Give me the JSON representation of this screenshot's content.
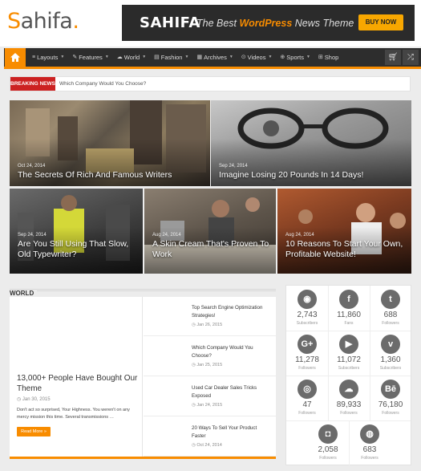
{
  "header": {
    "logo_s": "S",
    "logo_rest": "ahifa",
    "logo_dot": ".",
    "banner_brand": "SAHIFA",
    "banner_tag_pre": "The Best ",
    "banner_tag_bold": "WordPress",
    "banner_tag_post": " News Theme",
    "banner_button": "BUY NOW"
  },
  "nav": {
    "items": [
      {
        "icon": "≡",
        "label": "Layouts"
      },
      {
        "icon": "✎",
        "label": "Features"
      },
      {
        "icon": "☁",
        "label": "World"
      },
      {
        "icon": "▤",
        "label": "Fashion"
      },
      {
        "icon": "▦",
        "label": "Archives"
      },
      {
        "icon": "⊙",
        "label": "Videos"
      },
      {
        "icon": "⊕",
        "label": "Sports"
      },
      {
        "icon": "⊞",
        "label": "Shop"
      }
    ],
    "cart_icon": "cart-icon",
    "random_icon": "shuffle-icon"
  },
  "breaking": {
    "label": "Breaking News",
    "text": "Which Company Would You Choose?"
  },
  "slider": [
    {
      "date": "Oct 24, 2014",
      "title": "The Secrets Of Rich And Famous Writers"
    },
    {
      "date": "Sep 24, 2014",
      "title": "Imagine Losing 20 Pounds In 14 Days!"
    },
    {
      "date": "Sep 24, 2014",
      "title": "Are You Still Using That Slow, Old Typewriter?"
    },
    {
      "date": "Aug 24, 2014",
      "title": "A Skin Cream That's Proven To Work"
    },
    {
      "date": "Aug 24, 2014",
      "title": "10 Reasons To Start Your Own, Profitable Website!"
    }
  ],
  "world": {
    "heading": "World",
    "featured": {
      "title": "13,000+ People Have Bought Our Theme",
      "date": "Jan 30, 2015",
      "excerpt": "Don't act so surprised, Your Highness. You weren't on any mercy mission this time. Several transmissions …",
      "more": "Read More »"
    },
    "posts": [
      {
        "title": "Top Search Engine Optimization Strategies!",
        "date": "Jan 26, 2015"
      },
      {
        "title": "Which Company Would You Choose?",
        "date": "Jan 25, 2015"
      },
      {
        "title": "Used Car Dealer Sales Tricks Exposed",
        "date": "Jan 24, 2015"
      },
      {
        "title": "20 Ways To Sell Your Product Faster",
        "date": "Oct 24, 2014"
      }
    ]
  },
  "social": [
    {
      "icon": "rss-icon",
      "glyph": "◉",
      "count": "2,743",
      "label": "Subscribers"
    },
    {
      "icon": "facebook-icon",
      "glyph": "f",
      "count": "11,860",
      "label": "Fans"
    },
    {
      "icon": "twitter-icon",
      "glyph": "t",
      "count": "688",
      "label": "Followers"
    },
    {
      "icon": "googleplus-icon",
      "glyph": "G+",
      "count": "11,278",
      "label": "Followers"
    },
    {
      "icon": "youtube-icon",
      "glyph": "▶",
      "count": "11,072",
      "label": "Subscribers"
    },
    {
      "icon": "vimeo-icon",
      "glyph": "v",
      "count": "1,360",
      "label": "Subscribers"
    },
    {
      "icon": "dribbble-icon",
      "glyph": "◎",
      "count": "47",
      "label": "Followers"
    },
    {
      "icon": "soundcloud-icon",
      "glyph": "☁",
      "count": "89,933",
      "label": "Followers"
    },
    {
      "icon": "behance-icon",
      "glyph": "Bē",
      "count": "76,180",
      "label": "Followers"
    },
    {
      "icon": "instagram-icon",
      "glyph": "◘",
      "count": "2,058",
      "label": "Followers"
    },
    {
      "icon": "github-icon",
      "glyph": "◍",
      "count": "683",
      "label": "Followers"
    }
  ],
  "colors": {
    "accent": "#f88c00",
    "nav_bg": "#2d2d2d",
    "breaking": "#cc2222"
  }
}
